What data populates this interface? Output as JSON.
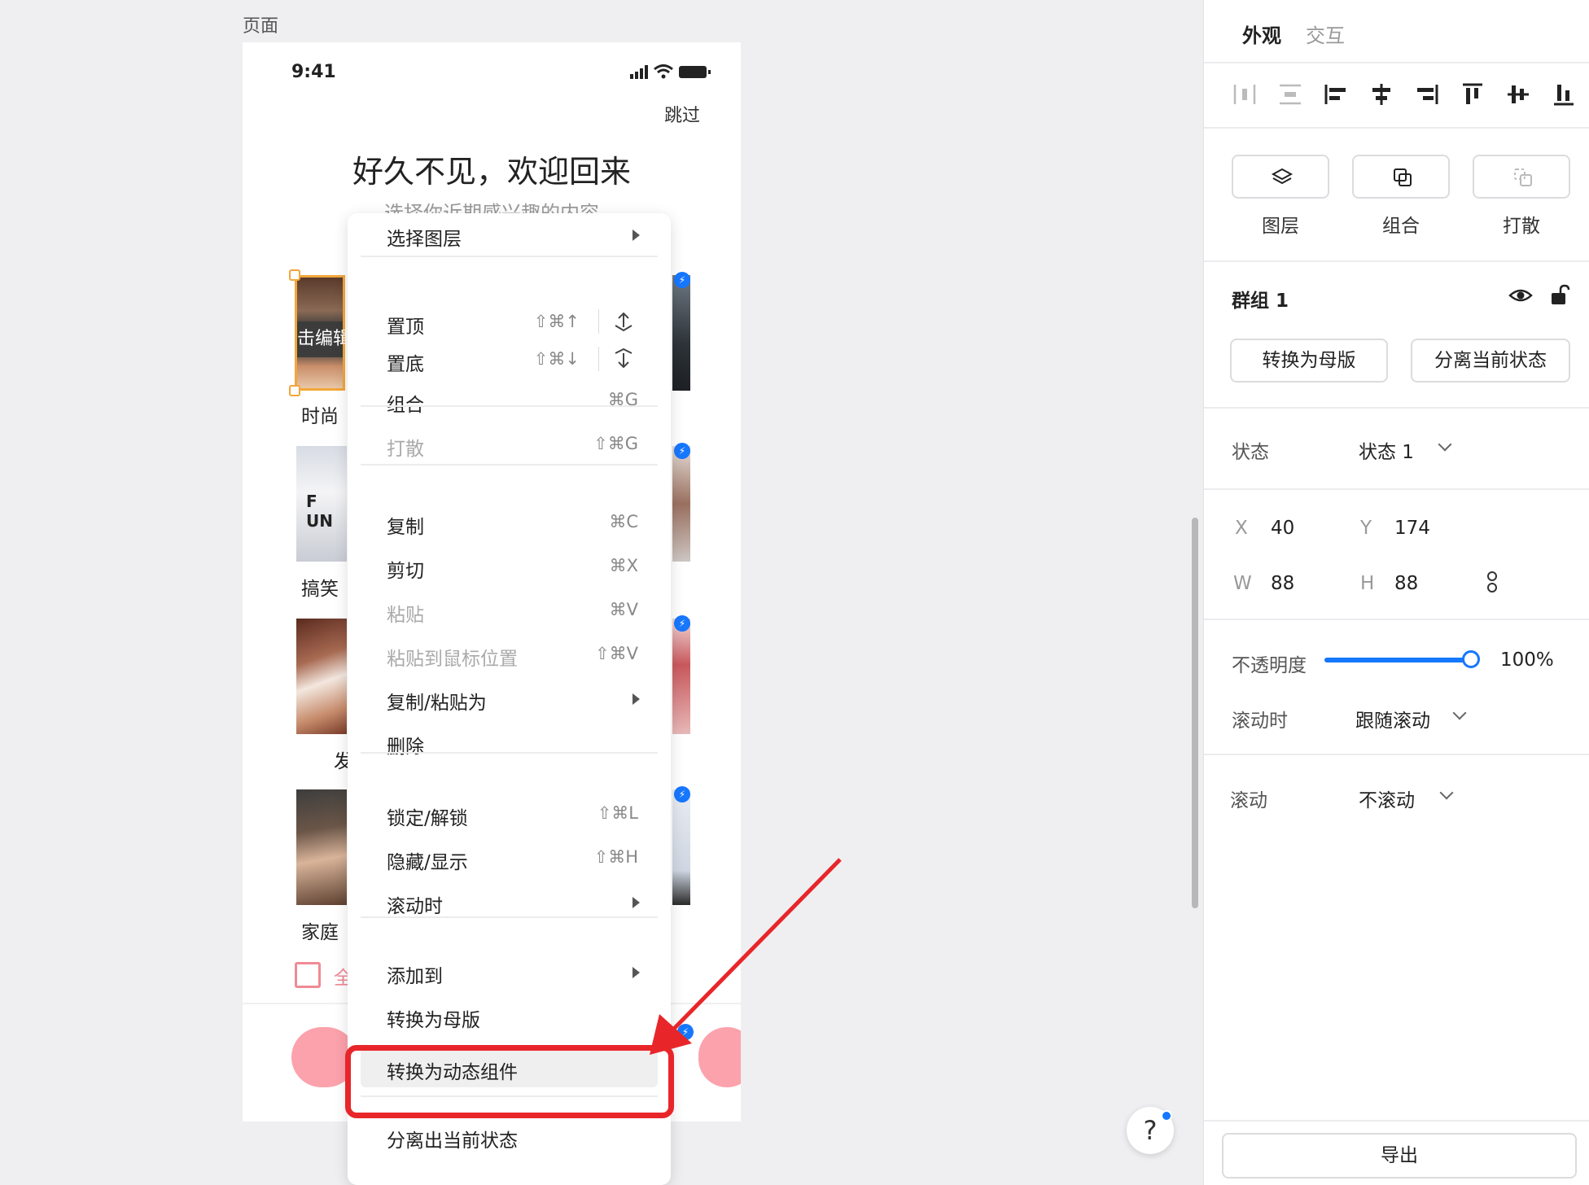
{
  "canvas": {
    "page_label": "页面",
    "status_time": "9:41",
    "skip_label": "跳过",
    "welcome_title": "好久不见，欢迎回来",
    "welcome_sub": "选择你近期感兴趣的内容",
    "selected_tile_text": "击编辑",
    "tile_labels": [
      "时尚",
      "搞笑",
      "发",
      "家庭"
    ],
    "tile_fun_text": "F UN",
    "checkbox_text": "全"
  },
  "context_menu": {
    "items": [
      {
        "label": "选择图层",
        "submenu": true
      },
      {
        "label": "置顶",
        "shortcut": "⇧⌘↑",
        "icon": "bring-to-front-icon"
      },
      {
        "label": "置底",
        "shortcut": "⇧⌘↓",
        "icon": "send-to-back-icon"
      },
      {
        "label": "组合",
        "shortcut": "⌘G"
      },
      {
        "label": "打散",
        "shortcut": "⇧⌘G",
        "disabled": true
      },
      {
        "label": "复制",
        "shortcut": "⌘C"
      },
      {
        "label": "剪切",
        "shortcut": "⌘X"
      },
      {
        "label": "粘贴",
        "shortcut": "⌘V",
        "disabled": true
      },
      {
        "label": "粘贴到鼠标位置",
        "shortcut": "⇧⌘V",
        "disabled": true
      },
      {
        "label": "复制/粘贴为",
        "submenu": true
      },
      {
        "label": "删除"
      },
      {
        "label": "锁定/解锁",
        "shortcut": "⇧⌘L"
      },
      {
        "label": "隐藏/显示",
        "shortcut": "⇧⌘H"
      },
      {
        "label": "滚动时",
        "submenu": true
      },
      {
        "label": "添加到",
        "submenu": true
      },
      {
        "label": "转换为母版"
      },
      {
        "label": "转换为动态组件",
        "highlighted": true
      },
      {
        "label": "分离出当前状态"
      }
    ]
  },
  "help": {
    "label": "?"
  },
  "panel": {
    "tabs": [
      {
        "label": "外观",
        "active": true
      },
      {
        "label": "交互",
        "active": false
      }
    ],
    "align_icons": [
      "distribute-horizontal-icon",
      "distribute-vertical-icon",
      "align-left-icon",
      "align-center-horizontal-icon",
      "align-right-icon",
      "align-top-icon",
      "align-center-vertical-icon",
      "align-bottom-icon"
    ],
    "tools": [
      {
        "label": "图层",
        "icon": "layers-icon"
      },
      {
        "label": "组合",
        "icon": "group-icon"
      },
      {
        "label": "打散",
        "icon": "ungroup-icon"
      }
    ],
    "group_title": "群组 1",
    "convert_master_label": "转换为母版",
    "detach_state_label": "分离当前状态",
    "state_label": "状态",
    "state_value": "状态 1",
    "x_key": "X",
    "x_value": "40",
    "y_key": "Y",
    "y_value": "174",
    "w_key": "W",
    "w_value": "88",
    "h_key": "H",
    "h_value": "88",
    "opacity_label": "不透明度",
    "opacity_value": "100%",
    "opacity_fraction": 1.0,
    "scroll_with_label": "滚动时",
    "scroll_with_value": "跟随滚动",
    "scroll_label": "滚动",
    "scroll_value": "不滚动",
    "export_label": "导出"
  },
  "colors": {
    "accent": "#1677ff",
    "highlight_box": "#e8262a",
    "selection": "#f2a63b",
    "pink": "#fca2ac"
  }
}
